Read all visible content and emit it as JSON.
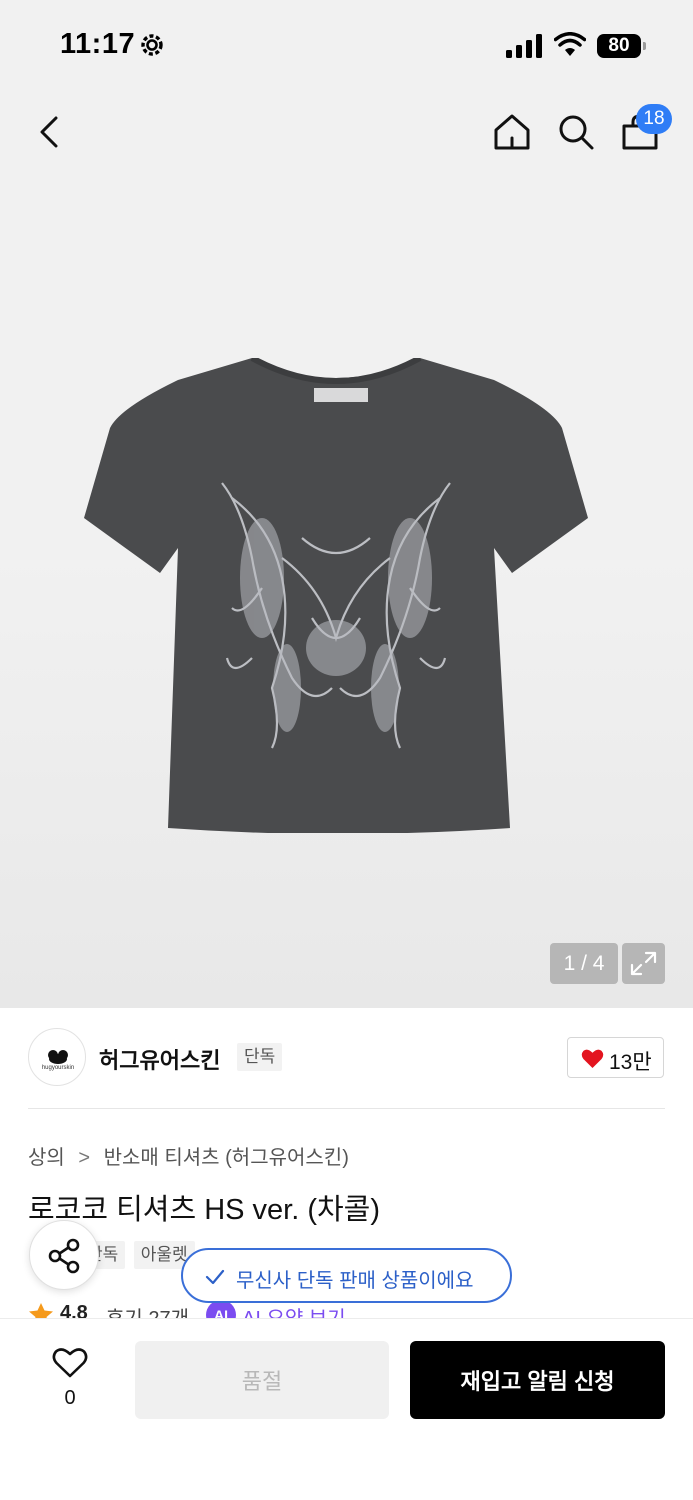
{
  "status_bar": {
    "time": "11:17",
    "battery": "80"
  },
  "nav": {
    "cart_count": "18"
  },
  "gallery": {
    "counter": "1 / 4"
  },
  "brand": {
    "logo_text": "hugyourskin",
    "name": "허그유어스킨",
    "tag": "단독",
    "likes": "13만"
  },
  "breadcrumb": [
    "상의",
    "반소매 티셔츠 (허그유어스킨)"
  ],
  "product": {
    "title": "로코코 티셔츠 HS ver. (차콜)",
    "tags": [
      "단독",
      "아울렛"
    ]
  },
  "toast": {
    "text": "무신사 단독 판매 상품이에요"
  },
  "rating": {
    "value": "4.8",
    "reviews": "후기 27개",
    "ai_badge": "AI",
    "ai_text": "AI 요약 보기"
  },
  "bottom_bar": {
    "wish_count": "0",
    "soldout_label": "품절",
    "restock_label": "재입고 알림 신청"
  },
  "colors": {
    "accent_blue": "#2f7df6",
    "toast_blue": "#2c60c8",
    "heart_red": "#e3141f",
    "ai_purple": "#7b4cf0",
    "star_orange": "#f59a1c"
  }
}
